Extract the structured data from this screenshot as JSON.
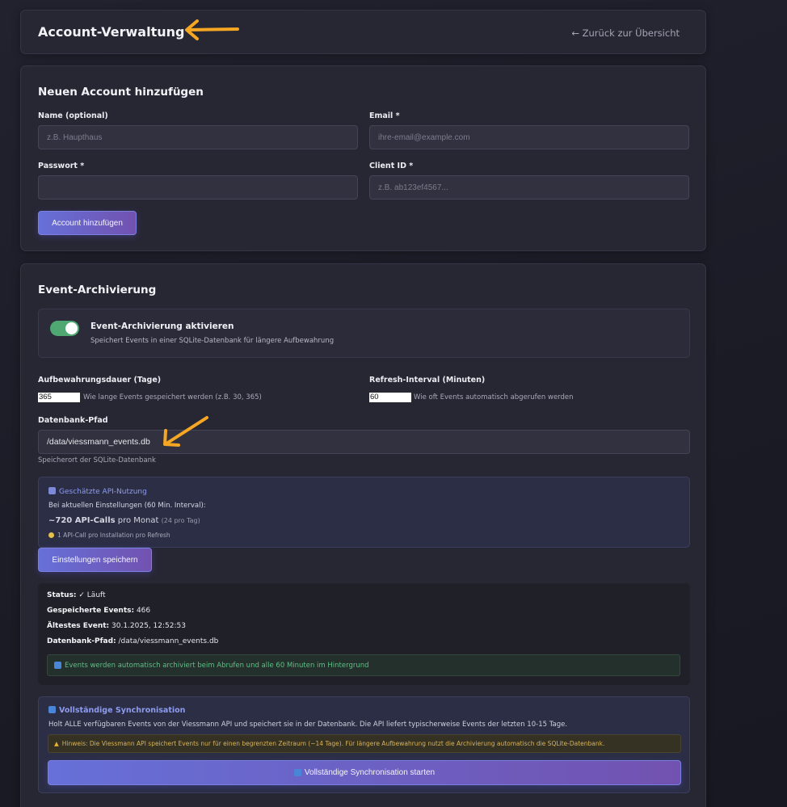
{
  "header": {
    "title": "Account-Verwaltung",
    "back_link": "← Zurück zur Übersicht"
  },
  "add_account": {
    "title": "Neuen Account hinzufügen",
    "name_label": "Name (optional)",
    "name_placeholder": "z.B. Haupthaus",
    "email_label": "Email *",
    "email_placeholder": "ihre-email@example.com",
    "password_label": "Passwort *",
    "client_id_label": "Client ID *",
    "client_id_placeholder": "z.B. ab123ef4567...",
    "submit_label": "Account hinzufügen"
  },
  "event_archive": {
    "title": "Event-Archivierung",
    "toggle_label": "Event-Archivierung aktivieren",
    "toggle_desc": "Speichert Events in einer SQLite-Datenbank für längere Aufbewahrung",
    "toggle_on": true,
    "retention_label": "Aufbewahrungsdauer (Tage)",
    "retention_value": "365",
    "retention_hint": "Wie lange Events gespeichert werden (z.B. 30, 365)",
    "refresh_label": "Refresh-Interval (Minuten)",
    "refresh_value": "60",
    "refresh_hint": "Wie oft Events automatisch abgerufen werden",
    "db_path_label": "Datenbank-Pfad",
    "db_path_value": "/data/viessmann_events.db",
    "db_path_hint": "Speicherort der SQLite-Datenbank",
    "api_usage": {
      "title": "Geschätzte API-Nutzung",
      "line1": "Bei aktuellen Einstellungen (60 Min. Interval):",
      "calls_bold": "~720 API-Calls",
      "calls_text": " pro Monat ",
      "calls_small": "(24 pro Tag)",
      "tip": "1 API-Call pro Installation pro Refresh"
    },
    "save_label": "Einstellungen speichern",
    "status": {
      "status_key": "Status:",
      "status_val": " ✓ Läuft",
      "saved_key": "Gespeicherte Events:",
      "saved_val": " 466",
      "oldest_key": "Ältestes Event:",
      "oldest_val": " 30.1.2025, 12:52:53",
      "path_key": "Datenbank-Pfad:",
      "path_val": " /data/viessmann_events.db",
      "info": "Events werden automatisch archiviert beim Abrufen und alle 60 Minuten im Hintergrund"
    },
    "sync": {
      "title": "Vollständige Synchronisation",
      "desc": "Holt ALLE verfügbaren Events von der Viessmann API und speichert sie in der Datenbank. Die API liefert typischerweise Events der letzten 10-15 Tage.",
      "warning": "Hinweis: Die Viessmann API speichert Events nur für einen begrenzten Zeitraum (~14 Tage). Für längere Aufbewahrung nutzt die Archivierung automatisch die SQLite-Datenbank.",
      "button": "Vollständige Synchronisation starten"
    }
  },
  "colors": {
    "accent": "#6670d8",
    "toggle_on": "#4fa872",
    "arrow": "#f5a623"
  }
}
